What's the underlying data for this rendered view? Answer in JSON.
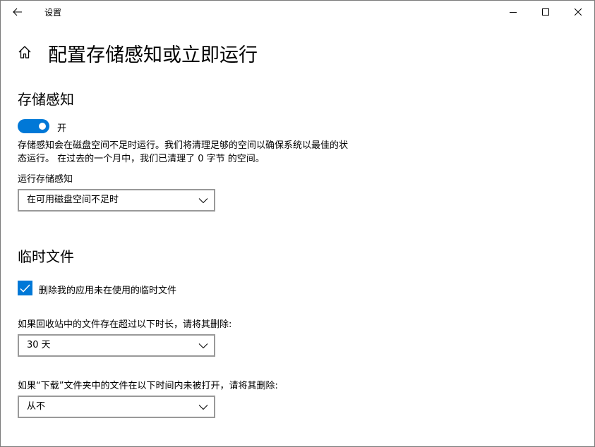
{
  "window": {
    "title": "设置"
  },
  "page": {
    "title": "配置存储感知或立即运行"
  },
  "storage_sense": {
    "section_title": "存储感知",
    "toggle_state": "开",
    "toggle_on": true,
    "description": "存储感知会在磁盘空间不足时运行。我们将清理足够的空间以确保系统以最佳的状态运行。 在过去的一个月中，我们已清理了 0 字节 的空间。",
    "run_label": "运行存储感知",
    "run_value": "在可用磁盘空间不足时"
  },
  "temp_files": {
    "section_title": "临时文件",
    "checkbox_label": "删除我的应用未在使用的临时文件",
    "checkbox_checked": true,
    "recycle_label": "如果回收站中的文件存在超过以下时长，请将其删除:",
    "recycle_value": "30 天",
    "downloads_label": "如果“下载”文件夹中的文件在以下时间内未被打开，请将其删除:",
    "downloads_value": "从不"
  },
  "colors": {
    "accent": "#0078d7",
    "border": "#999999"
  },
  "icons": {
    "back": "arrow-left-icon",
    "home": "home-icon",
    "minimize": "minimize-icon",
    "maximize": "maximize-icon",
    "close": "close-icon",
    "chevron": "chevron-down-icon",
    "check": "checkmark-icon"
  }
}
